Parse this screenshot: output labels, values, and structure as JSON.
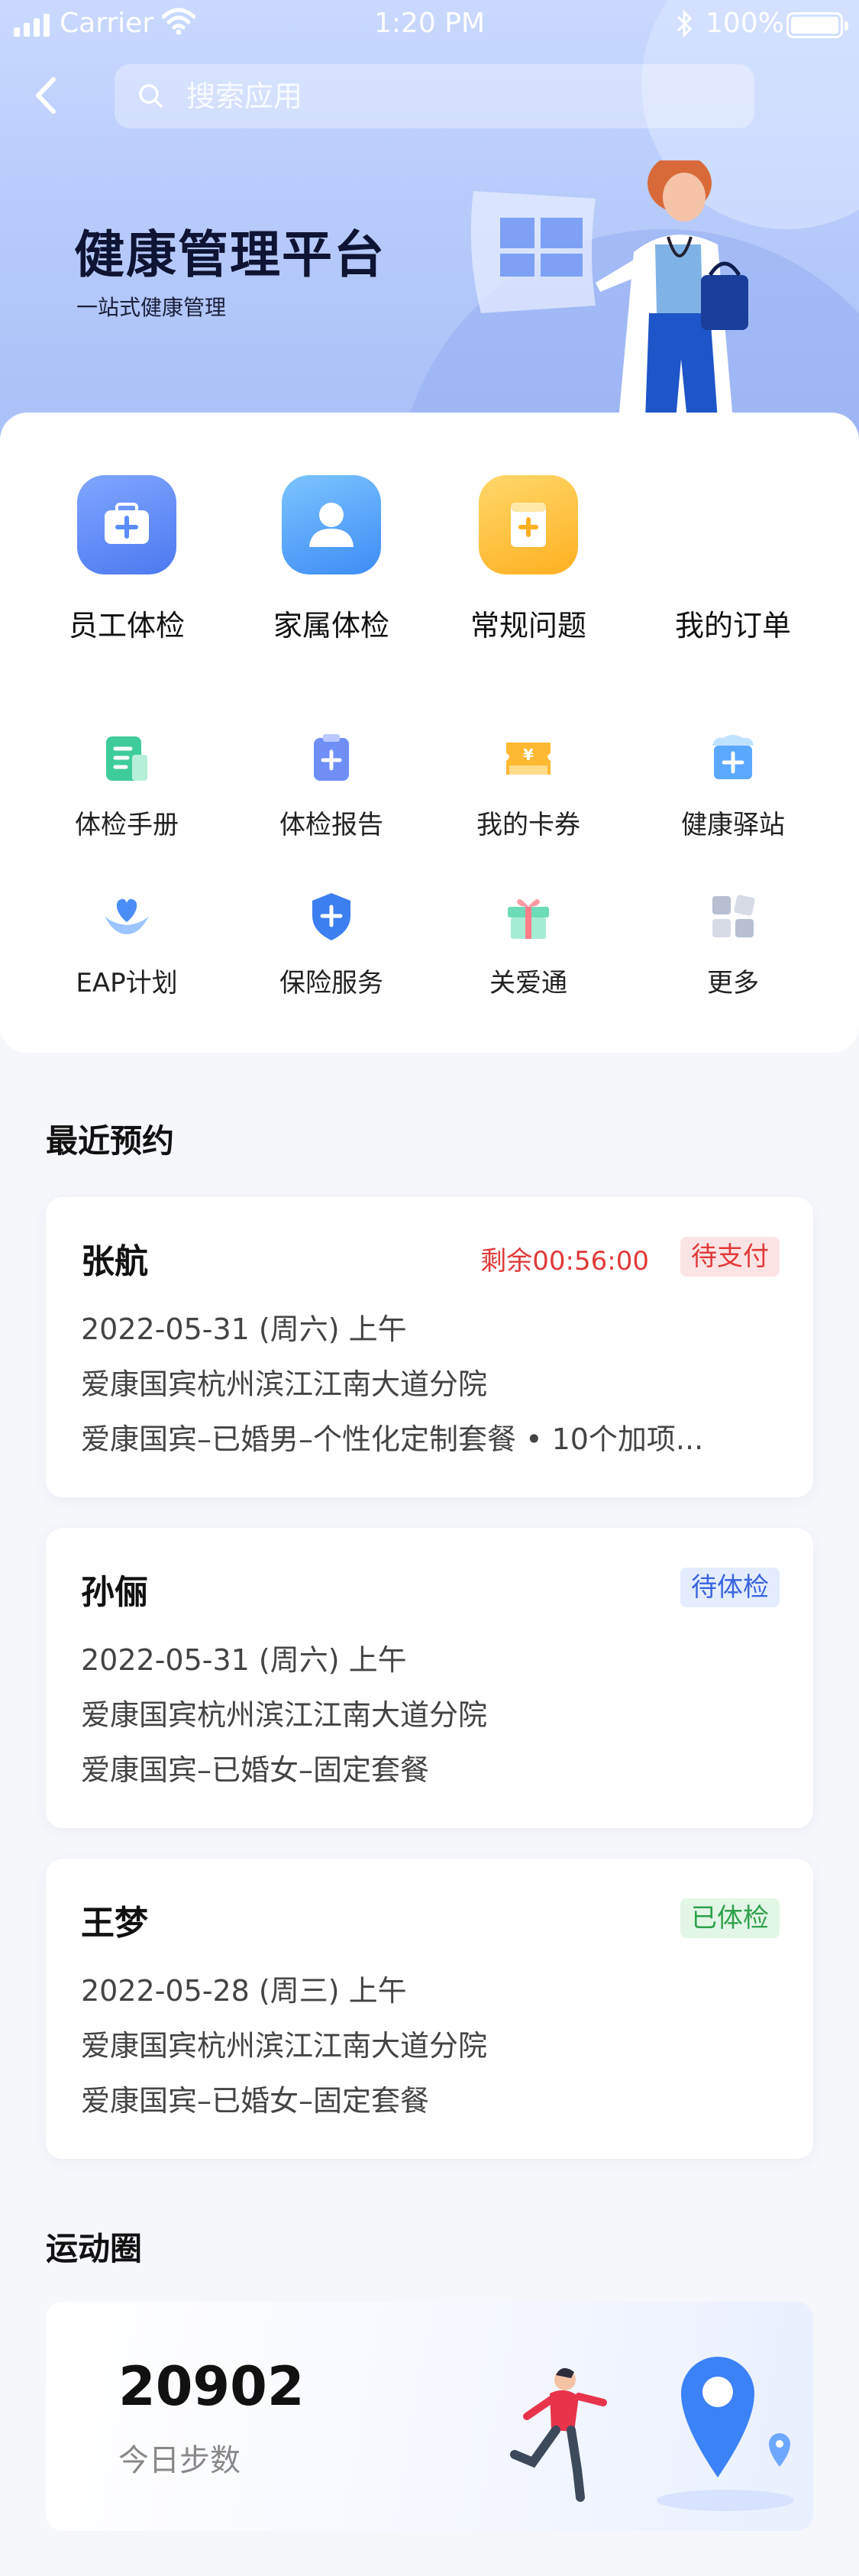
{
  "status_bar": {
    "carrier": "Carrier",
    "time": "1:20 PM",
    "battery": "100%"
  },
  "search": {
    "placeholder": "搜索应用"
  },
  "hero": {
    "title": "健康管理平台",
    "subtitle": "一站式健康管理"
  },
  "main_entries": [
    {
      "label": "员工体检",
      "icon": "medical-kit-icon",
      "color": "#5b8cff"
    },
    {
      "label": "家属体检",
      "icon": "person-icon",
      "color": "#4aa3ff"
    },
    {
      "label": "常规问题",
      "icon": "question-book-icon",
      "color": "#ffc233"
    },
    {
      "label": "我的订单",
      "icon": "",
      "color": ""
    }
  ],
  "services": [
    {
      "label": "体检手册",
      "icon": "handbook-icon"
    },
    {
      "label": "体检报告",
      "icon": "report-icon"
    },
    {
      "label": "我的卡券",
      "icon": "coupon-icon"
    },
    {
      "label": "健康驿站",
      "icon": "health-station-icon"
    },
    {
      "label": "EAP计划",
      "icon": "heart-hands-icon"
    },
    {
      "label": "保险服务",
      "icon": "insurance-shield-icon"
    },
    {
      "label": "关爱通",
      "icon": "gift-icon"
    },
    {
      "label": "更多",
      "icon": "more-grid-icon"
    }
  ],
  "recent": {
    "title": "最近预约",
    "items": [
      {
        "name": "张航",
        "countdown": "剩余00:56:00",
        "status": "待支付",
        "date": "2022-05-31 (周六) 上午",
        "hospital": "爱康国宾杭州滨江江南大道分院",
        "package": "爱康国宾–已婚男–个性化定制套餐 • 10个加项..."
      },
      {
        "name": "孙俪",
        "status": "待体检",
        "date": "2022-05-31 (周六) 上午",
        "hospital": "爱康国宾杭州滨江江南大道分院",
        "package": "爱康国宾–已婚女–固定套餐"
      },
      {
        "name": "王梦",
        "status": "已体检",
        "date": "2022-05-28 (周三) 上午",
        "hospital": "爱康国宾杭州滨江江南大道分院",
        "package": "爱康国宾–已婚女–固定套餐"
      }
    ]
  },
  "sport": {
    "title": "运动圈",
    "steps": "20902",
    "steps_label": "今日步数"
  },
  "colors": {
    "accent_blue": "#5b8cff",
    "status_red": "#e03a3a",
    "status_blue": "#3a64e0",
    "status_green": "#2ea04a"
  }
}
